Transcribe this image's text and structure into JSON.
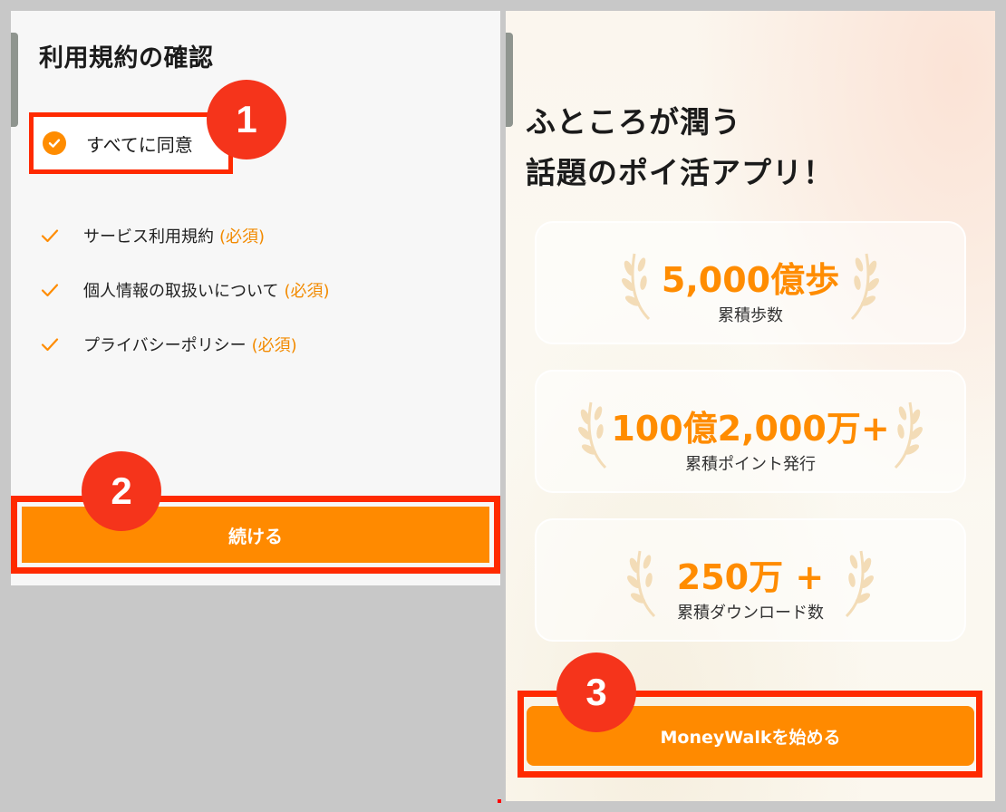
{
  "left": {
    "title": "利用規約の確認",
    "agree_all_label": "すべてに同意",
    "terms": [
      {
        "label": "サービス利用規約",
        "required": "(必須)"
      },
      {
        "label": "個人情報の取扱いについて",
        "required": "(必須)"
      },
      {
        "label": "プライバシーポリシー",
        "required": "(必須)"
      }
    ],
    "continue_label": "続ける"
  },
  "right": {
    "headline_line1": "ふところが潤う",
    "headline_line2": "話題のポイ活アプリ！",
    "stats": [
      {
        "value": "5,000億歩",
        "label": "累積歩数"
      },
      {
        "value": "100億2,000万+",
        "label": "累積ポイント発行"
      },
      {
        "value": "250万 +",
        "label": "累積ダウンロード数"
      }
    ],
    "start_label": "MoneyWalkを始める"
  },
  "badges": [
    "1",
    "2",
    "3"
  ],
  "colors": {
    "accent": "#ff8a00",
    "highlight_border": "#ff2a00",
    "badge": "#f5341b",
    "laurel": "#f3dcb7"
  },
  "icons": {
    "agree_all": "check-circle-icon",
    "term": "check-icon",
    "stat": "laurel-icon"
  }
}
